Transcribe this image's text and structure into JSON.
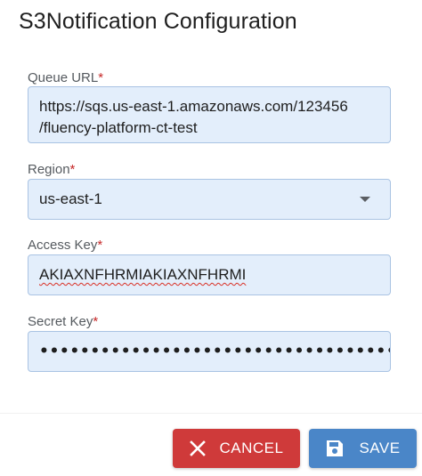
{
  "dialog": {
    "title": "S3Notification Configuration"
  },
  "form": {
    "queue_url": {
      "label": "Queue URL",
      "required_mark": "*",
      "value": "https://sqs.us-east-1.amazonaws.com/123456/fluency-platform-ct-test",
      "value_line1": "https://sqs.us-east-1.amazonaws.com/123456",
      "value_line2": "/fluency-platform-ct-test"
    },
    "region": {
      "label": "Region",
      "required_mark": "*",
      "value": "us-east-1",
      "icon": "dropdown-arrow-icon"
    },
    "access_key": {
      "label": "Access Key",
      "required_mark": "*",
      "value": "AKIAXNFHRMIAKIAXNFHRMI"
    },
    "secret_key": {
      "label": "Secret Key",
      "required_mark": "*",
      "masked_value": "••••••••••••••••••••••••••••••••••••••••••••••••••••••"
    }
  },
  "actions": {
    "cancel_label": "CANCEL",
    "cancel_icon": "close-icon",
    "save_label": "SAVE",
    "save_icon": "save-icon"
  },
  "colors": {
    "field_bg": "#e3eefb",
    "field_border": "#a9c3e3",
    "required": "#c62828",
    "cancel": "#cf3a3a",
    "save": "#4a86c8"
  }
}
